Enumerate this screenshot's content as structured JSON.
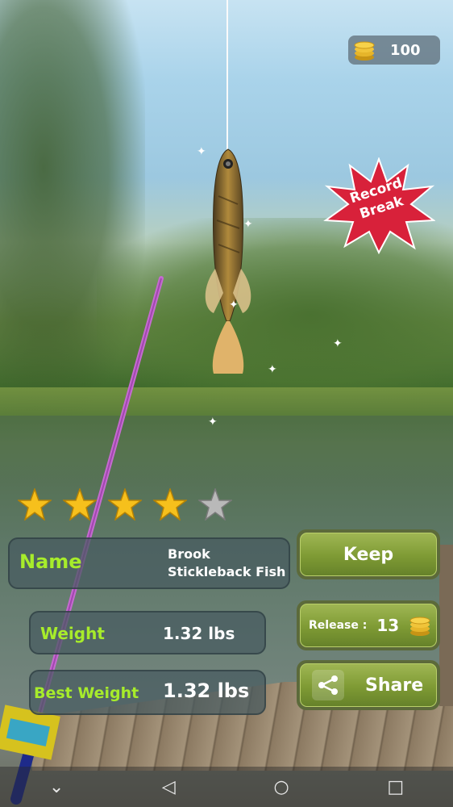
{
  "hud": {
    "coin_count": "100"
  },
  "badge": {
    "line1": "Record",
    "line2": "Break"
  },
  "rating": {
    "stars_filled": 4,
    "stars_total": 5
  },
  "fish_info": {
    "name_label": "Name",
    "name_value_line1": "Brook",
    "name_value_line2": "Stickleback Fish",
    "weight_label": "Weight",
    "weight_value": "1.32 lbs",
    "best_weight_label": "Best Weight",
    "best_weight_value": "1.32 lbs"
  },
  "actions": {
    "keep_label": "Keep",
    "release_label": "Release :",
    "release_reward": "13",
    "share_label": "Share"
  },
  "colors": {
    "label_green": "#a7ec2b",
    "button_green": "#7e9a34",
    "badge_red": "#d8213a"
  },
  "icons": [
    "coin-stack-icon",
    "star-icon",
    "share-icon",
    "back-icon",
    "home-icon",
    "recents-icon",
    "chevron-down-icon"
  ]
}
